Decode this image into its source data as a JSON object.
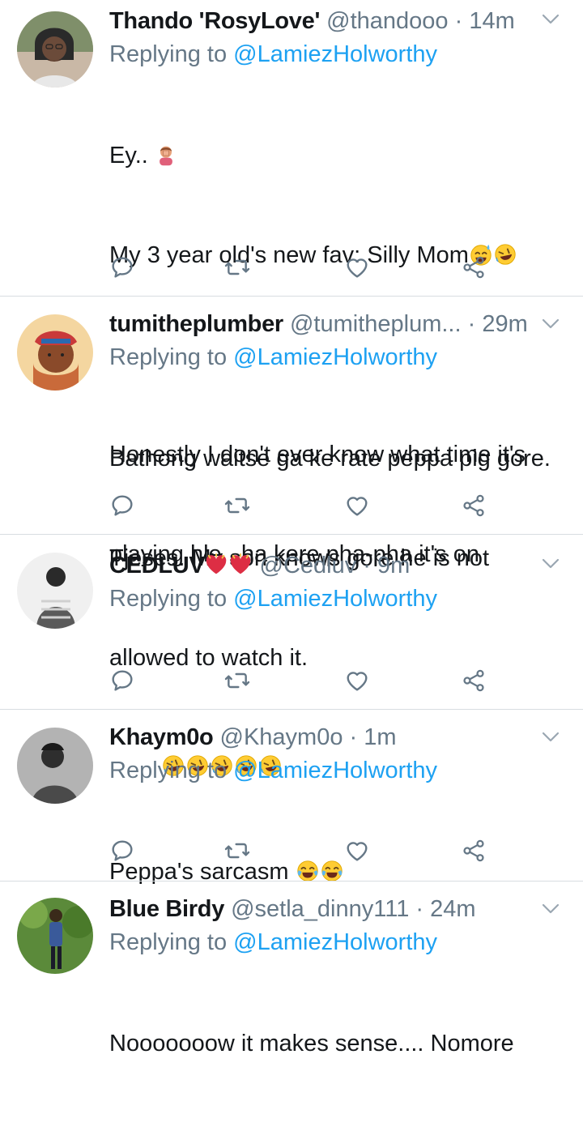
{
  "tweets": [
    {
      "name": "Thando 'RosyLove'",
      "handle": "@thandooo",
      "time": "14m",
      "replying_prefix": "Replying to ",
      "replying_to": "@LamiezHolworthy",
      "lines": [
        "Ey..",
        "My 3 year old's new fav: Silly Mom",
        "",
        "Honestly I don't ever know what time it's",
        "playing hle.. ha kere pha-pha it's on"
      ],
      "avatar_colors": [
        "#3a3a3a",
        "#c9b8a6",
        "#6b4b3a"
      ]
    },
    {
      "name": "tumitheplumber",
      "handle": "@tumitheplum...",
      "time": "29m",
      "replying_prefix": "Replying to ",
      "replying_to": "@LamiezHolworthy",
      "lines": [
        "Bathong waitse ga ke rate peppa pig gore.",
        "Tjeses. My son knows gore he is not",
        "allowed to watch it."
      ],
      "avatar_colors": [
        "#f4d6a0",
        "#c96a3a",
        "#8a4a2a"
      ]
    },
    {
      "name": "CEDLUV",
      "handle": "@Cedluv",
      "time": "9m",
      "replying_prefix": "Replying to ",
      "replying_to": "@LamiezHolworthy",
      "lines": [
        ""
      ],
      "avatar_colors": [
        "#f0f0f0",
        "#5a5a5a",
        "#2a2a2a"
      ]
    },
    {
      "name": "Khaym0o",
      "handle": "@Khaym0o",
      "time": "1m",
      "replying_prefix": "Replying to ",
      "replying_to": "@LamiezHolworthy",
      "lines": [
        "Peppa's sarcasm"
      ],
      "avatar_colors": [
        "#8a8a8a",
        "#dcdcdc",
        "#2e2e2e"
      ]
    },
    {
      "name": "Blue Birdy",
      "handle": "@setla_dinny111",
      "time": "24m",
      "replying_prefix": "Replying to ",
      "replying_to": "@LamiezHolworthy",
      "lines": [
        "Nooooooow it makes sense.... Nomore"
      ],
      "avatar_colors": [
        "#5b8a3a",
        "#3a5a9a",
        "#2a4a1a"
      ]
    }
  ],
  "icons": {
    "reply": "reply-icon",
    "retweet": "retweet-icon",
    "like": "like-icon",
    "share": "share-icon",
    "more": "chevron-down-icon"
  },
  "colors": {
    "link": "#1da1f2",
    "secondary": "#657786",
    "primary": "#14171a",
    "divider": "#d8dde1",
    "emoji_face": "#ffcc33",
    "heart": "#e0245e"
  }
}
